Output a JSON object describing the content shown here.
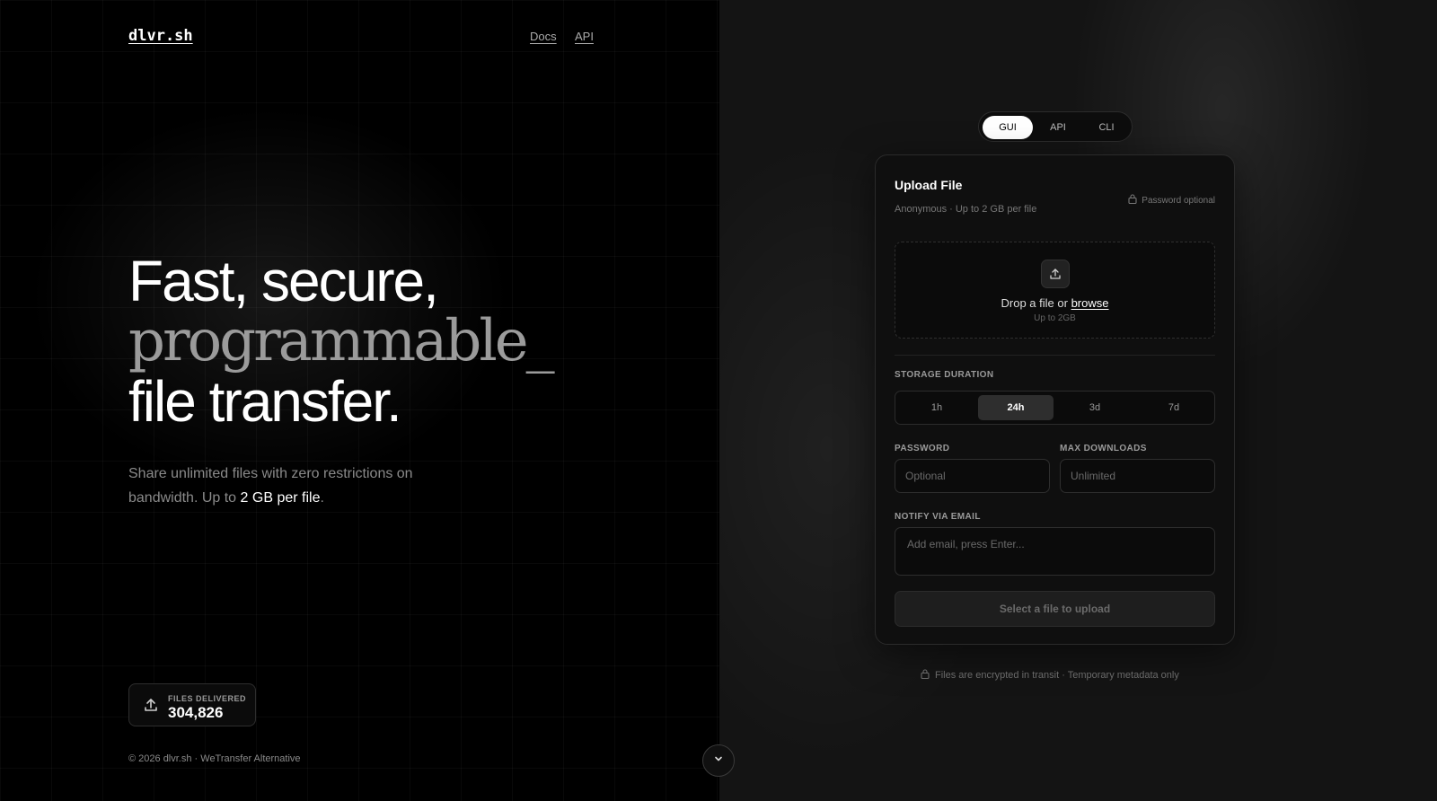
{
  "header": {
    "logo": "dlvr.sh",
    "nav": [
      {
        "label": "Docs"
      },
      {
        "label": "API"
      }
    ]
  },
  "hero": {
    "line1": "Fast, secure,",
    "line2": "programmable_",
    "line3": "file transfer.",
    "desc_text": "Share unlimited files with zero restrictions on bandwidth. Up to ",
    "desc_highlight": "2 GB per file",
    "desc_end": "."
  },
  "stats": {
    "label": "FILES DELIVERED",
    "value": "304,826",
    "icon": "upload-icon"
  },
  "footer": {
    "text": "© 2026 dlvr.sh · WeTransfer Alternative"
  },
  "mode_tabs": [
    {
      "label": "GUI",
      "active": true
    },
    {
      "label": "API",
      "active": false
    },
    {
      "label": "CLI",
      "active": false
    }
  ],
  "upload_card": {
    "title": "Upload File",
    "subtitle": "Anonymous · Up to 2 GB per file",
    "password_hint": "Password optional",
    "dropzone": {
      "text": "Drop a file or ",
      "browse": "browse",
      "sub": "Up to 2GB"
    },
    "storage": {
      "label": "STORAGE DURATION",
      "options": [
        "1h",
        "24h",
        "3d",
        "7d"
      ],
      "selected": "24h"
    },
    "password": {
      "label": "PASSWORD",
      "placeholder": "Optional"
    },
    "max_downloads": {
      "label": "MAX DOWNLOADS",
      "placeholder": "Unlimited"
    },
    "notify": {
      "label": "NOTIFY VIA EMAIL",
      "placeholder": "Add email, press Enter..."
    },
    "submit_label": "Select a file to upload"
  },
  "secure_note": "Files are encrypted in transit · Temporary metadata only",
  "colors": {
    "background": "#000000",
    "card": "#0f0f0f",
    "accent": "#ffffff",
    "muted": "#8a8a8a"
  }
}
